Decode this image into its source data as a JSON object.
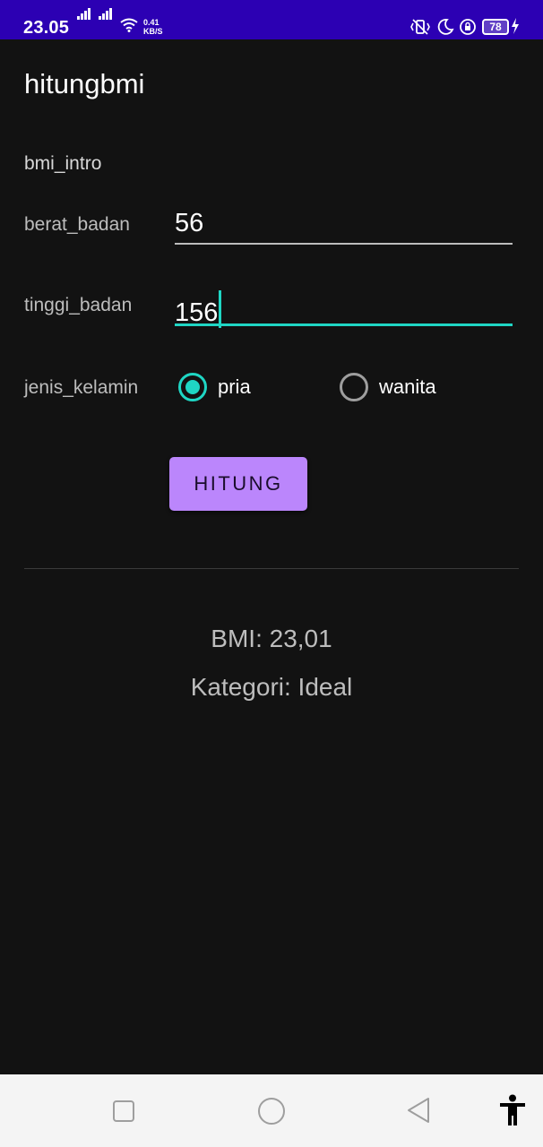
{
  "status_bar": {
    "time": "23.05",
    "speed_value": "0.41",
    "speed_unit": "KB/S",
    "battery": "78",
    "background_color": "#2c00b3"
  },
  "app": {
    "title": "hitungbmi",
    "intro": "bmi_intro",
    "weight": {
      "label": "berat_badan",
      "value": "56"
    },
    "height": {
      "label": "tinggi_badan",
      "value": "156"
    },
    "gender": {
      "label": "jenis_kelamin",
      "options": [
        {
          "label": "pria",
          "selected": true
        },
        {
          "label": "wanita",
          "selected": false
        }
      ]
    },
    "calculate_button": "HITUNG",
    "result_bmi": "BMI: 23,01",
    "result_category": "Kategori: Ideal"
  },
  "colors": {
    "background": "#121212",
    "accent": "#1fd6c4",
    "button": "#bb86fc"
  },
  "nav_bar": {
    "icons": [
      "recents-icon",
      "home-icon",
      "back-icon",
      "accessibility-icon"
    ]
  }
}
